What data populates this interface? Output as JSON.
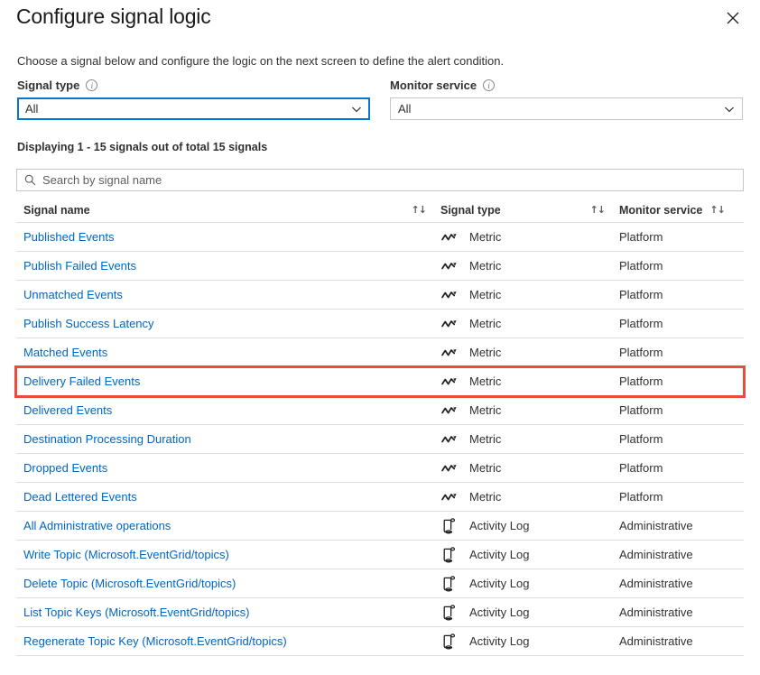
{
  "header": {
    "title": "Configure signal logic",
    "close_label": "×"
  },
  "description": "Choose a signal below and configure the logic on the next screen to define the alert condition.",
  "filters": {
    "signal_type": {
      "label": "Signal type",
      "value": "All",
      "info": "i"
    },
    "monitor_service": {
      "label": "Monitor service",
      "value": "All",
      "info": "i"
    }
  },
  "count_text": "Displaying 1 - 15 signals out of total 15 signals",
  "search": {
    "placeholder": "Search by signal name",
    "value": ""
  },
  "table": {
    "columns": [
      {
        "label": "Signal name",
        "sort": "↑↓"
      },
      {
        "label": "Signal type",
        "sort": "↑↓"
      },
      {
        "label": "Monitor service",
        "sort": "↑↓"
      }
    ],
    "rows": [
      {
        "name": "Published Events",
        "type": "Metric",
        "icon": "metric-line-icon",
        "service": "Platform",
        "highlighted": false
      },
      {
        "name": "Publish Failed Events",
        "type": "Metric",
        "icon": "metric-line-icon",
        "service": "Platform",
        "highlighted": false
      },
      {
        "name": "Unmatched Events",
        "type": "Metric",
        "icon": "metric-line-icon",
        "service": "Platform",
        "highlighted": false
      },
      {
        "name": "Publish Success Latency",
        "type": "Metric",
        "icon": "metric-line-icon",
        "service": "Platform",
        "highlighted": false
      },
      {
        "name": "Matched Events",
        "type": "Metric",
        "icon": "metric-line-icon",
        "service": "Platform",
        "highlighted": false
      },
      {
        "name": "Delivery Failed Events",
        "type": "Metric",
        "icon": "metric-line-icon",
        "service": "Platform",
        "highlighted": true
      },
      {
        "name": "Delivered Events",
        "type": "Metric",
        "icon": "metric-line-icon",
        "service": "Platform",
        "highlighted": false
      },
      {
        "name": "Destination Processing Duration",
        "type": "Metric",
        "icon": "metric-line-icon",
        "service": "Platform",
        "highlighted": false
      },
      {
        "name": "Dropped Events",
        "type": "Metric",
        "icon": "metric-line-icon",
        "service": "Platform",
        "highlighted": false
      },
      {
        "name": "Dead Lettered Events",
        "type": "Metric",
        "icon": "metric-line-icon",
        "service": "Platform",
        "highlighted": false
      },
      {
        "name": "All Administrative operations",
        "type": "Activity Log",
        "icon": "activity-log-scroll-icon",
        "service": "Administrative",
        "highlighted": false
      },
      {
        "name": "Write Topic (Microsoft.EventGrid/topics)",
        "type": "Activity Log",
        "icon": "activity-log-scroll-icon",
        "service": "Administrative",
        "highlighted": false
      },
      {
        "name": "Delete Topic (Microsoft.EventGrid/topics)",
        "type": "Activity Log",
        "icon": "activity-log-scroll-icon",
        "service": "Administrative",
        "highlighted": false
      },
      {
        "name": "List Topic Keys (Microsoft.EventGrid/topics)",
        "type": "Activity Log",
        "icon": "activity-log-scroll-icon",
        "service": "Administrative",
        "highlighted": false
      },
      {
        "name": "Regenerate Topic Key (Microsoft.EventGrid/topics)",
        "type": "Activity Log",
        "icon": "activity-log-scroll-icon",
        "service": "Administrative",
        "highlighted": false
      }
    ]
  },
  "colors": {
    "link": "#0066bf",
    "accent": "#0078d4",
    "highlight_outline": "#e74c3c",
    "row_divider": "#e1dfdd",
    "text": "#323130"
  }
}
